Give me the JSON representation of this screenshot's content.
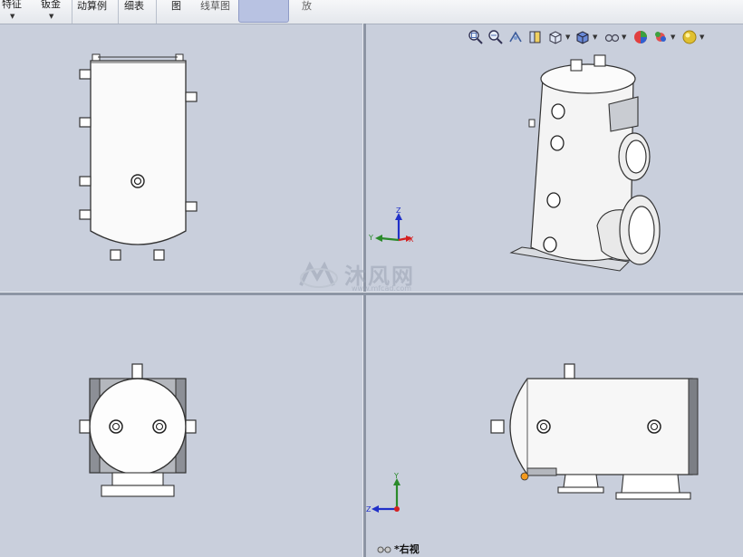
{
  "toolbar": {
    "items": [
      {
        "label": "特征"
      },
      {
        "label": "钣金"
      },
      {
        "label": "动算例"
      },
      {
        "label": "细表"
      },
      {
        "label": "图"
      },
      {
        "label": "线草图"
      },
      {
        "label": "放"
      }
    ]
  },
  "heads_up_toolbar": {
    "icons": [
      "zoom-to-fit-icon",
      "zoom-to-area-icon",
      "previous-view-icon",
      "section-view-icon",
      "view-orientation-icon",
      "display-style-icon",
      "hide-show-items-icon",
      "edit-appearance-icon",
      "apply-scene-icon",
      "view-settings-icon"
    ]
  },
  "triads": {
    "top_right": {
      "x": "X",
      "y": "Y",
      "z": "Z"
    },
    "bottom_right": {
      "y": "Y",
      "z": "Z"
    }
  },
  "watermark": {
    "text": "沐风网",
    "url": "www.mfcad.com"
  },
  "view_label": "*右视",
  "colors": {
    "viewport_bg": "#c9cfdc",
    "x_axis": "#d42020",
    "y_axis": "#2a8a2a",
    "z_axis": "#2030c8",
    "selected_tab": "#b8c2e2"
  }
}
